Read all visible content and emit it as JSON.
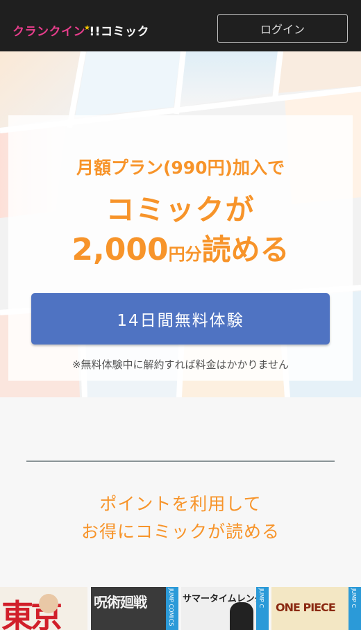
{
  "header": {
    "logo_part1": "クランクイン",
    "logo_part2": "!!",
    "logo_part3": "コミック",
    "login_label": "ログイン"
  },
  "hero": {
    "line1": "月額プラン(990円)加入で",
    "line2": "コミックが",
    "line3_amount": "2,000",
    "line3_unit": "円分",
    "line3_tail": "読める",
    "cta_label": "14日間無料体験",
    "note": "※無料体験中に解約すれば料金はかかりません"
  },
  "points": {
    "line1": "ポイントを利用して",
    "line2": "お得にコミックが読める"
  },
  "covers": [
    {
      "title": "東京",
      "spine": ""
    },
    {
      "title": "呪術廻戦",
      "spine": "JUMP COMICS"
    },
    {
      "title": "サマータイムレンダ",
      "spine": "JUMP C"
    },
    {
      "title": "ONE PIECE",
      "spine": "JUMP C"
    }
  ],
  "colors": {
    "accent": "#f7942a",
    "cta": "#4f73c2",
    "header_bg": "#1f1f1f",
    "logo_pink": "#e83e8c"
  }
}
